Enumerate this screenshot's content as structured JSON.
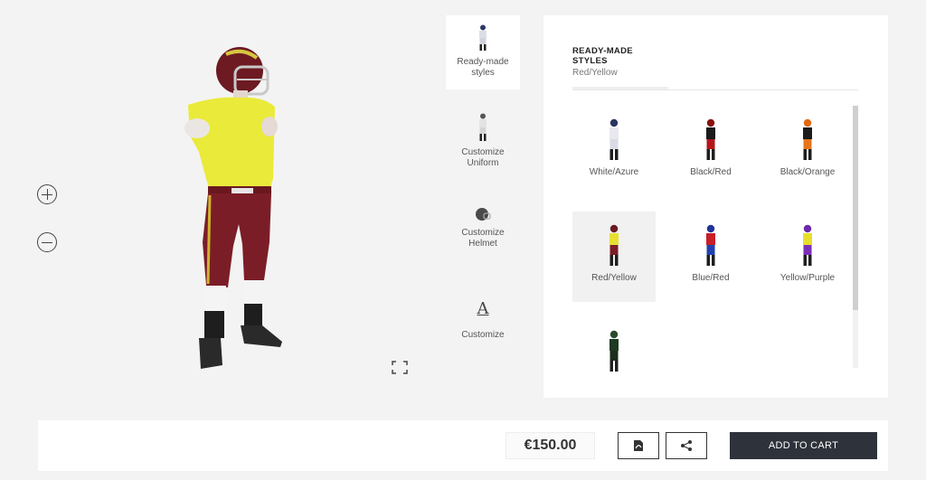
{
  "viewer": {
    "zoom_in": "zoom-in-icon",
    "zoom_out": "zoom-out-icon",
    "fullscreen": "fullscreen-icon"
  },
  "menu": {
    "items": [
      {
        "label": "Ready-made\nstyles",
        "icon": "player-icon",
        "active": true
      },
      {
        "label": "Customize\nUniform",
        "icon": "uniform-icon",
        "active": false
      },
      {
        "label": "Customize\nHelmet",
        "icon": "helmet-icon",
        "active": false
      },
      {
        "label": "Customize",
        "icon": "text-a-icon",
        "glyph": "A",
        "active": false
      }
    ]
  },
  "panel": {
    "title": "READY-MADE STYLES",
    "subtitle": "Red/Yellow",
    "styles": [
      {
        "label": "White/Azure",
        "jersey": "#e8e8ee",
        "pants": "#d9dbe6",
        "helmet": "#2a3560",
        "selected": false
      },
      {
        "label": "Black/Red",
        "jersey": "#1b1b1b",
        "pants": "#b3151b",
        "helmet": "#8a1010",
        "selected": false
      },
      {
        "label": "Black/Orange",
        "jersey": "#1c1c1c",
        "pants": "#e7751c",
        "helmet": "#e06a10",
        "selected": false
      },
      {
        "label": "Red/Yellow",
        "jersey": "#e7e033",
        "pants": "#7b1d27",
        "helmet": "#6a1a22",
        "selected": true
      },
      {
        "label": "Blue/Red",
        "jersey": "#c81f28",
        "pants": "#2340b0",
        "helmet": "#20349a",
        "selected": false
      },
      {
        "label": "Yellow/Purple",
        "jersey": "#e8df2b",
        "pants": "#7a2fb8",
        "helmet": "#6b2aa8",
        "selected": false
      },
      {
        "label": "",
        "jersey": "#1e3a22",
        "pants": "#1c2e1e",
        "helmet": "#2a4a2c",
        "selected": false
      }
    ]
  },
  "footer": {
    "price": "€150.00",
    "pdf_icon": "pdf-icon",
    "share_icon": "share-icon",
    "cart_label": "ADD TO CART"
  },
  "colors": {
    "cart_bg": "#2e333b",
    "jersey_main": "#eaea3a",
    "pants_main": "#7b1d27"
  }
}
